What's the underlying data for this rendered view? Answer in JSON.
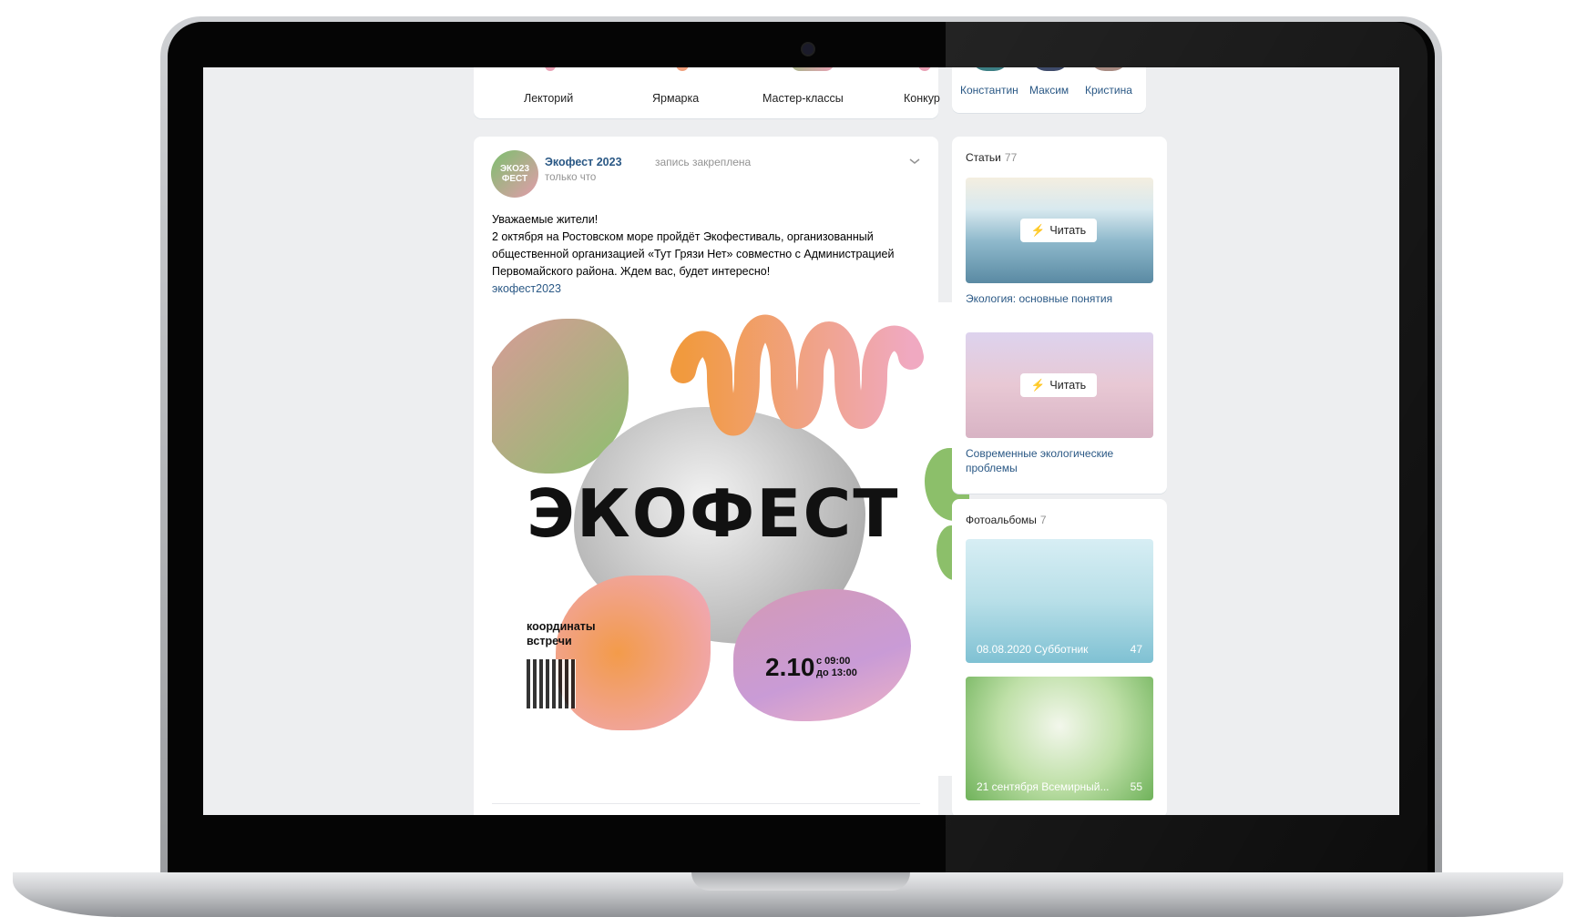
{
  "menu": {
    "items": [
      "Лекторий",
      "Ярмарка",
      "Мастер-классы",
      "Конкур"
    ]
  },
  "friends": [
    "Константин",
    "Максим",
    "Кристина"
  ],
  "post": {
    "author": "Экофест 2023",
    "avatar_text": "ЭКО23 ФЕСТ",
    "time": "только что",
    "pinned": "запись закреплена",
    "text_lines": [
      "Уважаемые жители!",
      "2 октября на Ростовском море пройдёт Экофестиваль, организованный",
      "общественной организацией «Тут Грязи Нет» совместно с Администрацией",
      "Первомайского района. Ждем вас, будет интересно!"
    ],
    "hashtag": "экофест2023",
    "poster": {
      "title": "ЭКОФЕСТ",
      "coords_line1": "координаты",
      "coords_line2": "встречи",
      "date": "2.10",
      "time_from": "с 09:00",
      "time_to": "до 13:00"
    }
  },
  "articles": {
    "title": "Статьи",
    "count": "77",
    "read_label": "Читать",
    "items": [
      {
        "title": "Экология: основные понятия"
      },
      {
        "title": "Современные экологические проблемы"
      }
    ]
  },
  "albums": {
    "title": "Фотоальбомы",
    "count": "7",
    "items": [
      {
        "caption": "08.08.2020 Субботник",
        "count": "47"
      },
      {
        "caption": "21 сентября Всемирный...",
        "count": "55"
      }
    ]
  },
  "colors": {
    "link": "#2a5885",
    "page_bg": "#edeef0",
    "card_bg": "#ffffff"
  }
}
